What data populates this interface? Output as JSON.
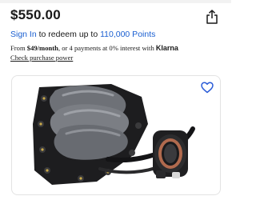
{
  "listing": {
    "price": "$550.00"
  },
  "rewards": {
    "signin_link": "Sign In",
    "text": " to redeem up to ",
    "points_link": "110,000 Points"
  },
  "financing": {
    "prefix": "From ",
    "monthly": "$49/month",
    "middle": ", or 4 payments at 0% interest with ",
    "brand": "Klarna",
    "link": "Check purchase power"
  },
  "icons": {
    "share": "share-icon",
    "favorite": "heart-icon"
  },
  "colors": {
    "link": "#1a5fd1",
    "text": "#191919"
  }
}
